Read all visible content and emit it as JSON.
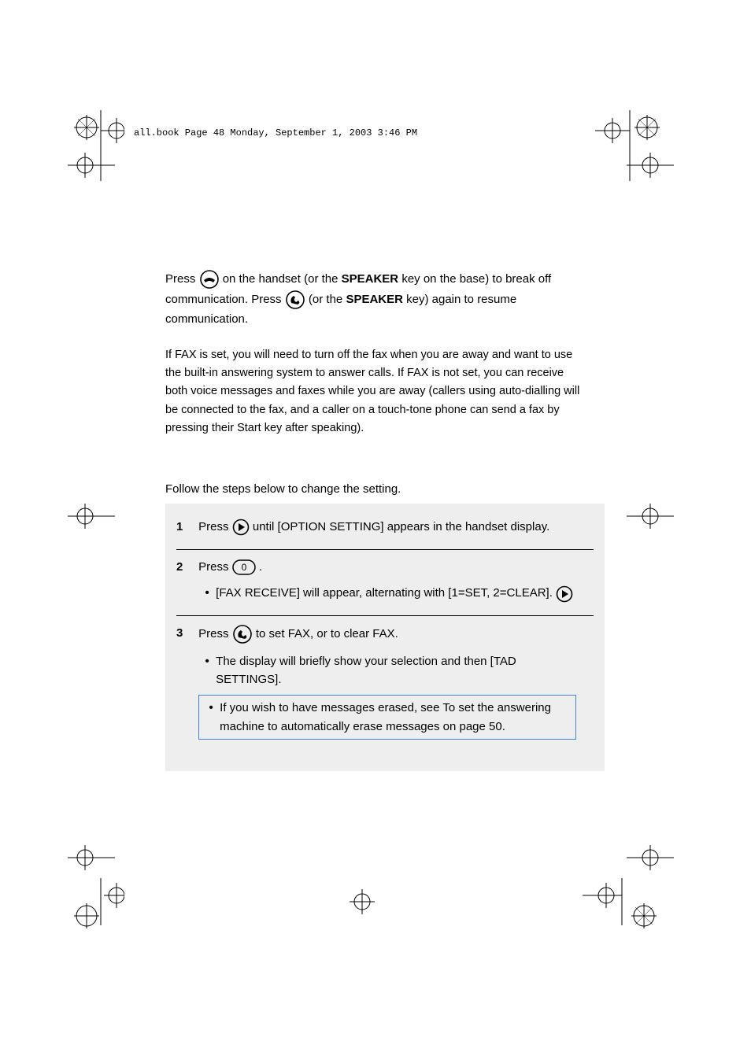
{
  "header": {
    "slug": "all.book  Page 48  Monday, September 1, 2003  3:46 PM"
  },
  "body": {
    "p1a": "Press ",
    "p1b": " on the handset (or the ",
    "p1c": "SPEAKER",
    "p1d": " key on the base) to break off communication. Press ",
    "p1e": " (or the ",
    "p1f": "SPEAKER",
    "p1g": " key) again to resume communication.",
    "p2": "If FAX is set, you will need to turn off the fax when you are away and want to use the built-in answering system to answer calls. If FAX is not set, you can receive both voice messages and faxes while you are away (callers using auto-dialling will be connected to the fax, and a caller on a touch-tone phone can send a fax by pressing their Start key after speaking).",
    "p3": "Follow the steps below to change the setting."
  },
  "steps": {
    "s1": {
      "num": "1",
      "text_a": "Press ",
      "text_b": " until [OPTION SETTING] appears in the handset display."
    },
    "s2": {
      "num": "2",
      "text_a": "Press ",
      "text_b": ".",
      "bullet": "[FAX RECEIVE] will appear, alternating with [1=SET, 2=CLEAR].",
      "bullet_tail_a": " will appear, alternating with ",
      "bullet_tail_b": "."
    },
    "s3": {
      "num": "3",
      "text_a": "Press ",
      "text_b": " to set FAX, or ",
      "text_c": " to clear FAX.",
      "bullet1": "The display will briefly show your selection and then [TAD SETTINGS].",
      "bullet2": "If you wish to have messages erased, see To set the answering machine to automatically erase messages on page 50."
    }
  }
}
